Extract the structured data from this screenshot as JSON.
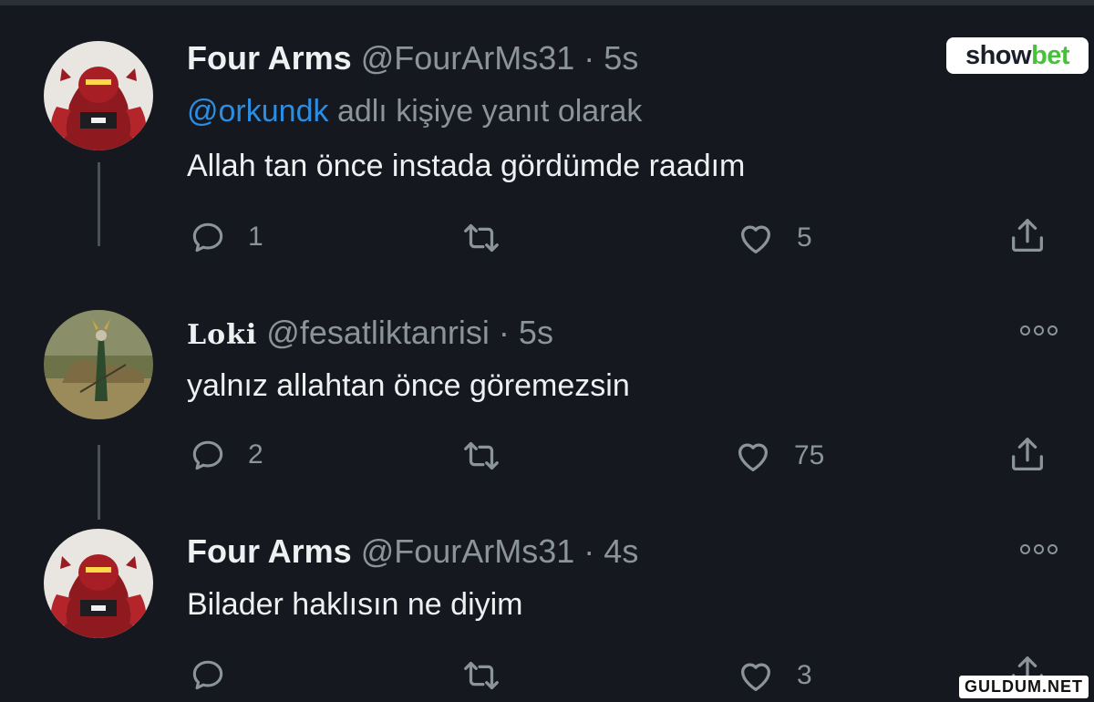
{
  "logo": {
    "show": "show",
    "bet": "bet"
  },
  "watermark": "GULDUM.NET",
  "tweets": [
    {
      "name": "Four Arms",
      "handle": "@FourArMs31",
      "separator": "·",
      "time": "5s",
      "reply_mention": "@orkundk",
      "reply_text": "adlı kişiye yanıt olarak",
      "text": "Allah tan önce instada gördümde raadım",
      "replies": "1",
      "retweets": "",
      "likes": "5"
    },
    {
      "name": "Loki",
      "handle": "@fesatliktanrisi",
      "separator": "·",
      "time": "5s",
      "text": "yalnız allahtan önce göremezsin",
      "replies": "2",
      "retweets": "",
      "likes": "75"
    },
    {
      "name": "Four Arms",
      "handle": "@FourArMs31",
      "separator": "·",
      "time": "4s",
      "text": "Bilader haklısın ne diyim",
      "replies": "",
      "retweets": "",
      "likes": "3"
    }
  ],
  "icons": {
    "reply": "reply-icon",
    "retweet": "retweet-icon",
    "like": "heart-icon",
    "share": "share-icon",
    "more": "more-options-icon"
  },
  "colors": {
    "background": "#15181f",
    "text": "#eef0f1",
    "muted": "#8b939b",
    "link": "#2b8ee3",
    "brand_green": "#46c13a"
  }
}
